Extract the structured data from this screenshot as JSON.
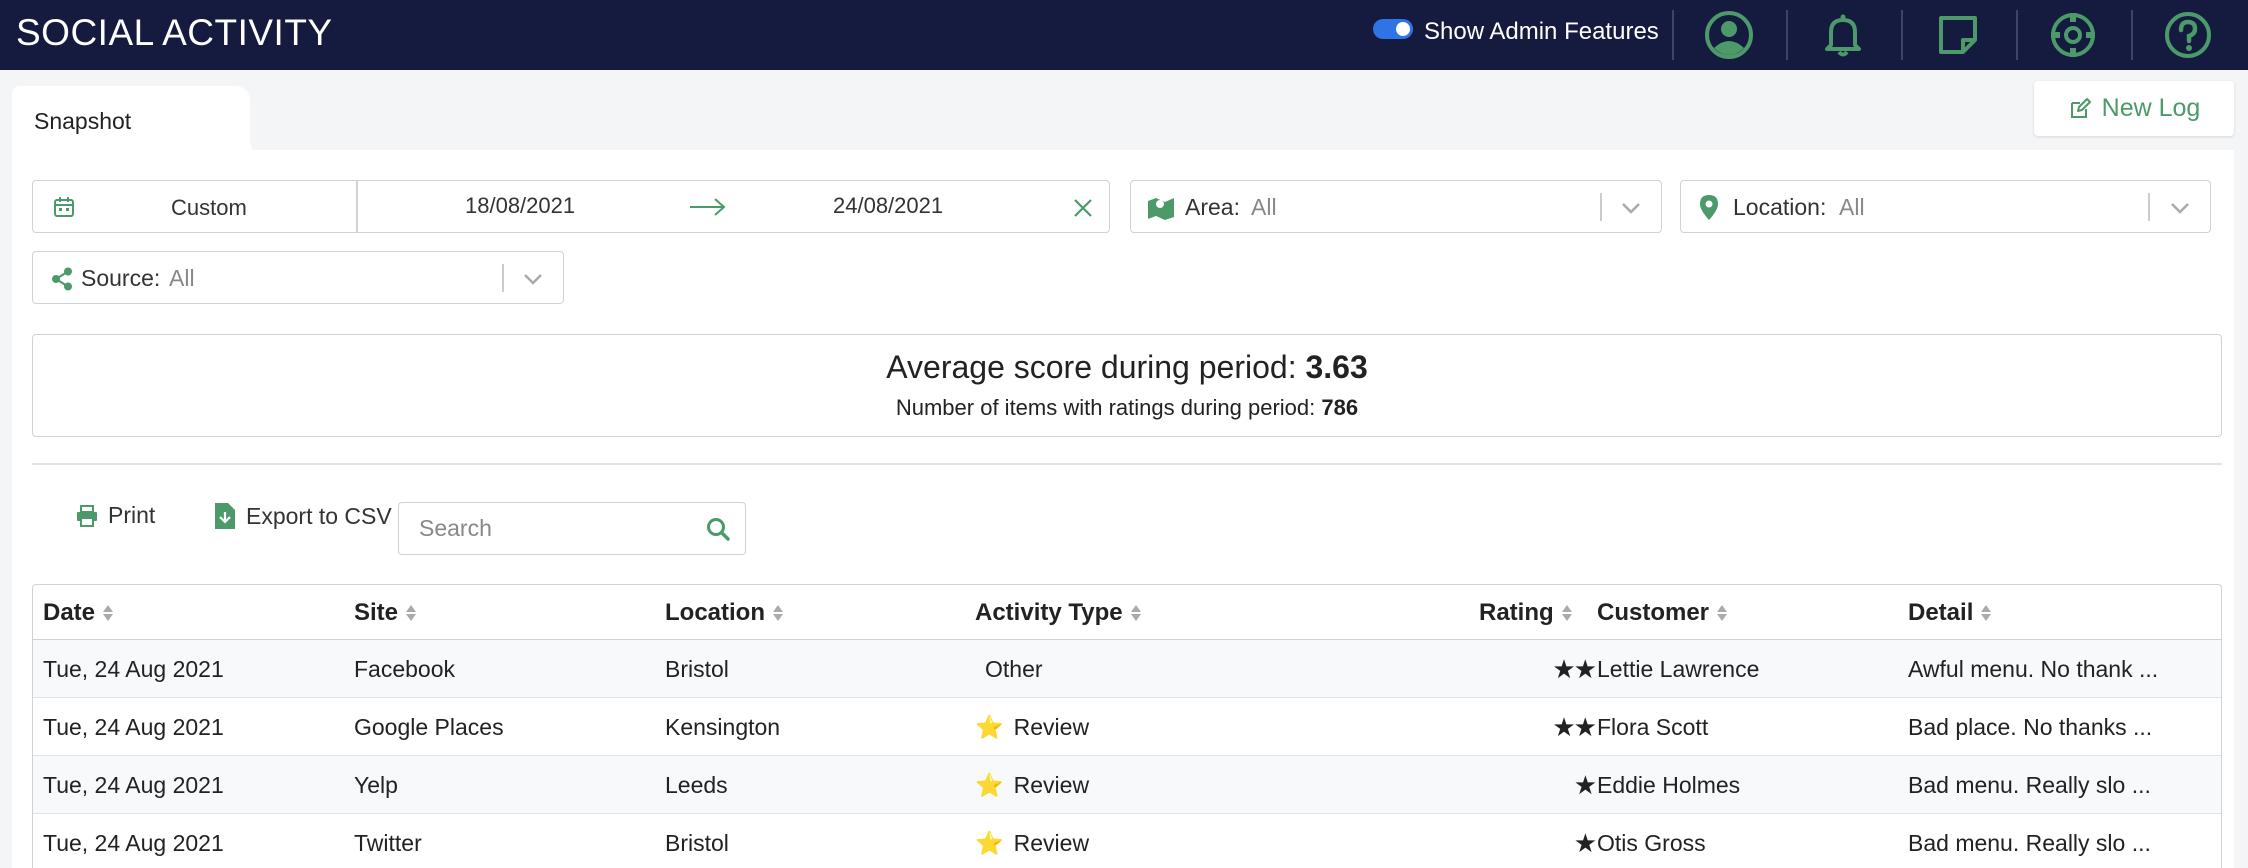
{
  "header": {
    "title": "SOCIAL ACTIVITY",
    "admin_toggle_label": "Show Admin Features",
    "admin_toggle_on": true,
    "icons": [
      "user-icon",
      "bell-icon",
      "note-icon",
      "settings-icon",
      "help-icon"
    ],
    "icon_color": "#4c9a6a"
  },
  "tabs": {
    "active": "Snapshot"
  },
  "new_log_label": "New Log",
  "filters": {
    "date_mode": "Custom",
    "date_from": "18/08/2021",
    "date_to": "24/08/2021",
    "area_label": "Area:",
    "area_value": "All",
    "location_label": "Location:",
    "location_value": "All",
    "source_label": "Source:",
    "source_value": "All"
  },
  "summary": {
    "avg_label": "Average score during period:",
    "avg_value": "3.63",
    "count_label": "Number of items with ratings during period:",
    "count_value": "786"
  },
  "toolbar": {
    "print_label": "Print",
    "export_label": "Export to CSV",
    "search_placeholder": "Search"
  },
  "table": {
    "columns": [
      "Date",
      "Site",
      "Location",
      "Activity Type",
      "Rating",
      "Customer",
      "Detail"
    ],
    "rows": [
      {
        "date": "Tue, 24 Aug 2021",
        "site": "Facebook",
        "location": "Bristol",
        "activity": "Other",
        "activity_icon": "",
        "rating": 2,
        "rating_text": "★★",
        "customer": "Lettie Lawrence",
        "detail": "Awful menu. No thank ..."
      },
      {
        "date": "Tue, 24 Aug 2021",
        "site": "Google Places",
        "location": "Kensington",
        "activity": "Review",
        "activity_icon": "⭐",
        "rating": 2,
        "rating_text": "★★",
        "customer": "Flora Scott",
        "detail": "Bad place. No thanks ..."
      },
      {
        "date": "Tue, 24 Aug 2021",
        "site": "Yelp",
        "location": "Leeds",
        "activity": "Review",
        "activity_icon": "⭐",
        "rating": 1,
        "rating_text": "★",
        "customer": "Eddie Holmes",
        "detail": "Bad menu. Really slo ..."
      },
      {
        "date": "Tue, 24 Aug 2021",
        "site": "Twitter",
        "location": "Bristol",
        "activity": "Review",
        "activity_icon": "⭐",
        "rating": 1,
        "rating_text": "★",
        "customer": "Otis Gross",
        "detail": "Bad menu. Really slo ..."
      }
    ]
  },
  "colors": {
    "header_bg": "#141b3e",
    "accent_green": "#4c9a6a",
    "toggle_blue": "#2e74e6"
  }
}
